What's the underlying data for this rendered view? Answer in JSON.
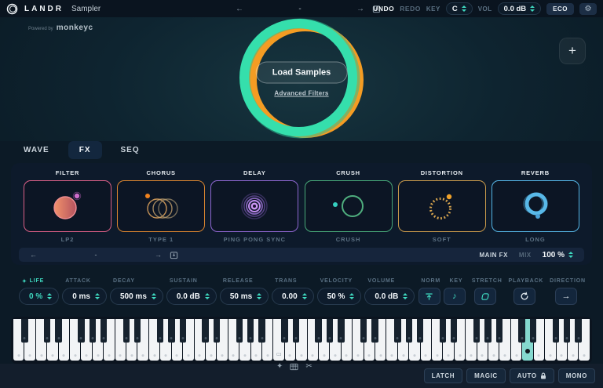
{
  "colors": {
    "accent_teal": "#3fd9c0",
    "ring_teal": "#35dfac",
    "ring_orange": "#f49c23"
  },
  "icons": {
    "back": "←",
    "forward": "→",
    "plus": "+",
    "gear": "⚙",
    "sparkle": "✦",
    "scissors": "✂",
    "note": "♪",
    "arrow_right": "→"
  },
  "header": {
    "brand": "LANDR",
    "product": "Sampler",
    "preset_name": "-",
    "undo_label": "UNDO",
    "redo_label": "REDO",
    "key_label": "KEY",
    "key_value": "C",
    "vol_label": "VOL",
    "vol_value": "0.0 dB",
    "eco_label": "ECO"
  },
  "powered_by": {
    "prefix": "Powered by",
    "brand": "monkeyc"
  },
  "hero": {
    "load_button": "Load Samples",
    "advanced_link": "Advanced Filters"
  },
  "tabs": [
    {
      "label": "WAVE",
      "active": false
    },
    {
      "label": "FX",
      "active": true
    },
    {
      "label": "SEQ",
      "active": false
    }
  ],
  "fx": {
    "cards": [
      {
        "name": "FILTER",
        "preset": "LP2",
        "color": "#d95f86"
      },
      {
        "name": "CHORUS",
        "preset": "TYPE 1",
        "color": "#d8842f"
      },
      {
        "name": "DELAY",
        "preset": "PING PONG SYNC",
        "color": "#8e66cf"
      },
      {
        "name": "CRUSH",
        "preset": "CRUSH",
        "color": "#47a878"
      },
      {
        "name": "DISTORTION",
        "preset": "SOFT",
        "color": "#c99a4b"
      },
      {
        "name": "REVERB",
        "preset": "LONG",
        "color": "#55b5e5"
      }
    ],
    "bar": {
      "preset_name": "-",
      "main_fx_label": "MAIN FX",
      "mix_label": "MIX",
      "mix_value": "100 %"
    }
  },
  "params": [
    {
      "label": "LIFE",
      "value": "0 %",
      "accent": true
    },
    {
      "label": "ATTACK",
      "value": "0 ms",
      "accent": false
    },
    {
      "label": "DECAY",
      "value": "500 ms",
      "accent": false
    },
    {
      "label": "SUSTAIN",
      "value": "0.0 dB",
      "accent": false
    },
    {
      "label": "RELEASE",
      "value": "50 ms",
      "accent": false
    },
    {
      "label": "TRANS",
      "value": "0.00",
      "accent": false
    },
    {
      "label": "VELOCITY",
      "value": "50 %",
      "accent": false
    },
    {
      "label": "VOLUME",
      "value": "0.0 dB",
      "accent": false
    }
  ],
  "toggles": [
    {
      "label": "NORM"
    },
    {
      "label": "KEY"
    },
    {
      "label": "STRETCH"
    },
    {
      "label": "PLAYBACK"
    },
    {
      "label": "DIRECTION"
    }
  ],
  "keyboard": {
    "white_keys": 51,
    "start_note": "A",
    "highlight_index": 45,
    "labels": {
      "23": "C3"
    }
  },
  "footer": {
    "buttons": [
      {
        "label": "LATCH",
        "lock": false
      },
      {
        "label": "MAGIC",
        "lock": false
      },
      {
        "label": "AUTO",
        "lock": true
      },
      {
        "label": "MONO",
        "lock": false
      }
    ]
  }
}
